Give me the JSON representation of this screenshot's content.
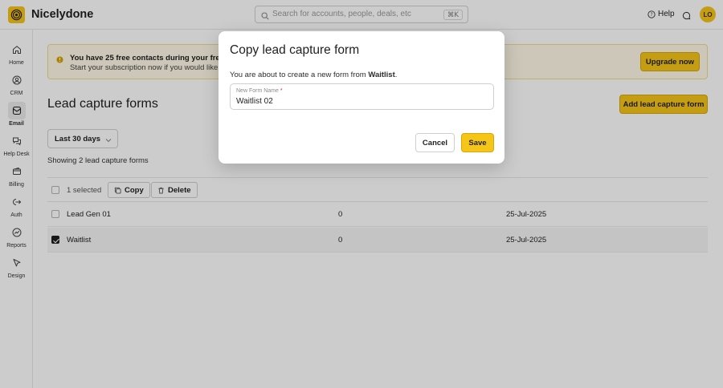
{
  "app": {
    "brand": "Nicelydone",
    "brand_color": "#f5c518"
  },
  "header": {
    "search_placeholder": "Search for accounts, people, deals, etc",
    "search_shortcut": "⌘K",
    "help_label": "Help",
    "avatar_initials": "LO"
  },
  "sidebar": {
    "items": [
      {
        "label": "Home",
        "icon": "home-icon"
      },
      {
        "label": "CRM",
        "icon": "crm-icon"
      },
      {
        "label": "Email",
        "icon": "email-icon",
        "active": true
      },
      {
        "label": "Help Desk",
        "icon": "helpdesk-icon"
      },
      {
        "label": "Billing",
        "icon": "billing-icon"
      },
      {
        "label": "Auth",
        "icon": "auth-icon"
      },
      {
        "label": "Reports",
        "icon": "reports-icon"
      },
      {
        "label": "Design",
        "icon": "design-icon"
      }
    ]
  },
  "banner": {
    "title": "You have 25 free contacts during your free trial",
    "subtitle": "Start your subscription now if you would like to i",
    "upgrade_label": "Upgrade now"
  },
  "page": {
    "title": "Lead capture forms",
    "add_label": "Add lead capture form",
    "range_label": "Last 30 days",
    "showing_text": "Showing 2 lead capture forms"
  },
  "table": {
    "selected_text": "1 selected",
    "copy_label": "Copy",
    "delete_label": "Delete",
    "rows": [
      {
        "name": "Lead Gen 01",
        "count": "0",
        "date": "25-Jul-2025",
        "checked": false
      },
      {
        "name": "Waitlist",
        "count": "0",
        "date": "25-Jul-2025",
        "checked": true
      }
    ]
  },
  "modal": {
    "title": "Copy lead capture form",
    "desc_prefix": "You are about to create a new form from ",
    "desc_source": "Waitlist",
    "desc_suffix": ".",
    "field_label": "New Form Name",
    "field_required": "*",
    "field_value": "Waitlist 02",
    "cancel_label": "Cancel",
    "save_label": "Save"
  }
}
